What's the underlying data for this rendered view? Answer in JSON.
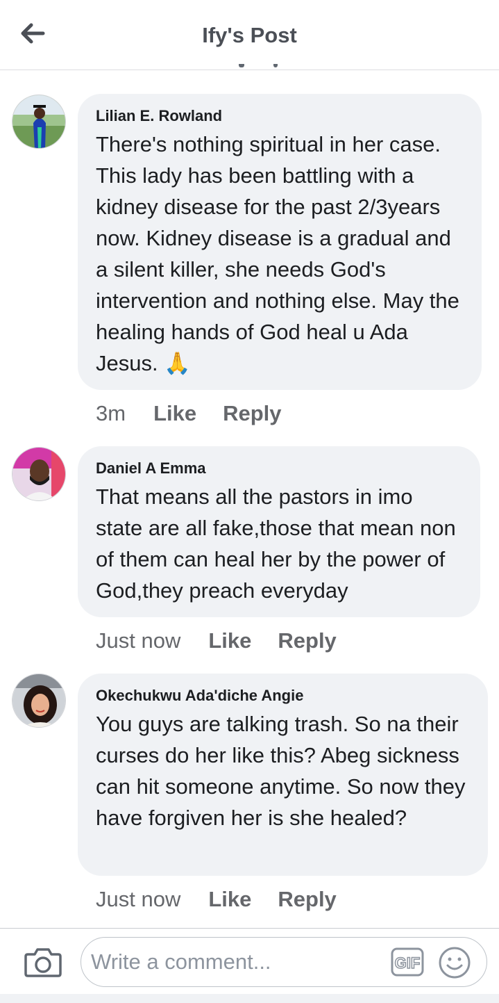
{
  "header": {
    "title": "Ify's Post"
  },
  "comments": [
    {
      "author": "Lilian E. Rowland",
      "text": "There's nothing spiritual in her case. This lady has been battling with a kidney disease for the past 2/3years now. Kidney disease is a gradual and a silent killer, she needs God's intervention and nothing else. May the healing hands of God heal u Ada Jesus. 🙏",
      "time": "3m",
      "like_label": "Like",
      "reply_label": "Reply"
    },
    {
      "author": "Daniel A Emma",
      "text": "That means all the pastors in imo state are all fake,those that mean non of them can heal her by the power of God,they preach everyday",
      "time": "Just now",
      "like_label": "Like",
      "reply_label": "Reply"
    },
    {
      "author": "Okechukwu Ada'diche Angie",
      "text": "You guys are talking trash. So na their curses do her like this? Abeg sickness can hit someone anytime. So now they have forgiven her is she healed?",
      "time": "Just now",
      "like_label": "Like",
      "reply_label": "Reply"
    }
  ],
  "composer": {
    "placeholder": "Write a comment...",
    "gif_label": "GIF"
  },
  "icons": {
    "back": "arrow-left-icon",
    "camera": "camera-icon",
    "gif": "gif-icon",
    "emoji": "smiley-icon"
  }
}
